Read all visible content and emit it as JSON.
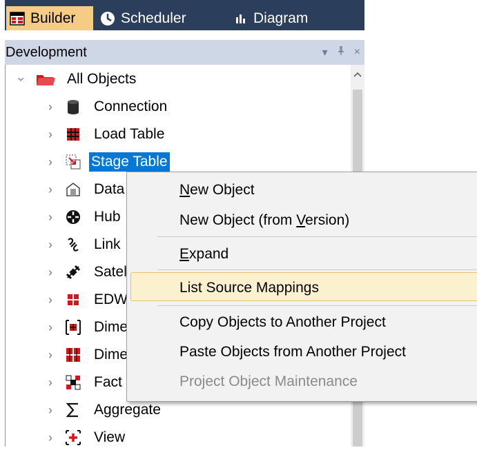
{
  "tabs": [
    {
      "label": "Builder",
      "icon": "builder-icon",
      "active": true
    },
    {
      "label": "Scheduler",
      "icon": "clock-icon",
      "active": false
    },
    {
      "label": "Diagram",
      "icon": "diagram-icon",
      "active": false
    }
  ],
  "panel": {
    "title": "Development",
    "controls": [
      "▾",
      "ꟷ",
      "×"
    ]
  },
  "tree": {
    "root": {
      "label": "All Objects",
      "icon": "folder-icon"
    },
    "items": [
      {
        "label": "Connection",
        "icon": "database-icon"
      },
      {
        "label": "Load Table",
        "icon": "load-table-icon"
      },
      {
        "label": "Stage Table",
        "icon": "stage-table-icon",
        "selected": true
      },
      {
        "label": "Data",
        "icon": "data-store-icon"
      },
      {
        "label": "Hub",
        "icon": "hub-icon"
      },
      {
        "label": "Link",
        "icon": "link-icon"
      },
      {
        "label": "Satel",
        "icon": "satellite-icon"
      },
      {
        "label": "EDW",
        "icon": "edw-icon"
      },
      {
        "label": "Dime",
        "icon": "dimension-icon"
      },
      {
        "label": "Dime",
        "icon": "dimension-view-icon"
      },
      {
        "label": "Fact",
        "icon": "fact-icon"
      },
      {
        "label": "Aggregate",
        "icon": "sigma-icon"
      },
      {
        "label": "View",
        "icon": "view-icon"
      }
    ]
  },
  "context_menu": {
    "items": [
      {
        "pre": "",
        "key": "N",
        "post": "ew Object",
        "disabled": false
      },
      {
        "pre": "New Object (from ",
        "key": "V",
        "post": "ersion)",
        "disabled": false
      },
      {
        "pre": "",
        "key": "E",
        "post": "xpand",
        "disabled": false
      },
      {
        "pre": "List Source Mappings",
        "key": "",
        "post": "",
        "disabled": false,
        "highlighted": true
      },
      {
        "pre": "Copy Objects to Another Project",
        "key": "",
        "post": "",
        "disabled": false
      },
      {
        "pre": "Paste Objects from Another Project",
        "key": "",
        "post": "",
        "disabled": false
      },
      {
        "pre": "Project Object Maintenance",
        "key": "",
        "post": "",
        "disabled": true
      }
    ]
  },
  "colors": {
    "tab_bar": "#2b3f5c",
    "active_tab": "#f5cc84",
    "panel_header": "#cfd7e6",
    "selection": "#0078d7",
    "menu_highlight": "#fcf1cf",
    "icon_red": "#d9141b"
  }
}
